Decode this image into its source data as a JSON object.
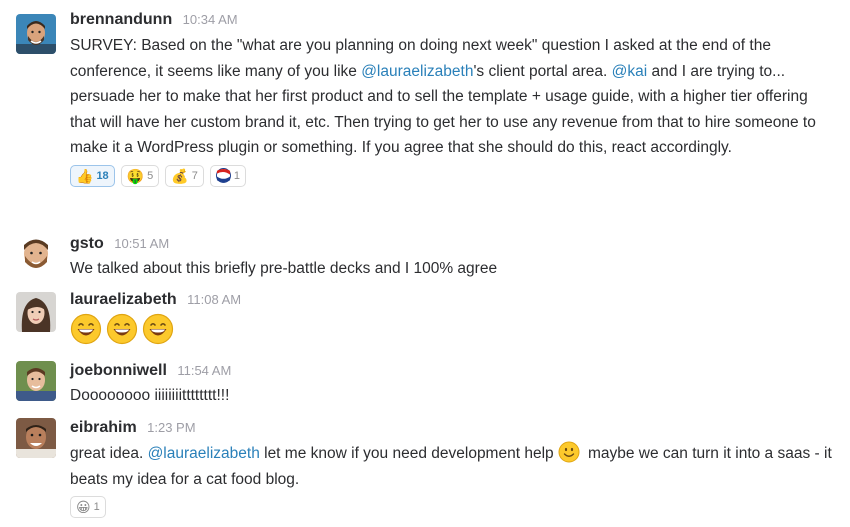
{
  "messages": [
    {
      "author": "brennandunn",
      "time": "10:34 AM",
      "parts": [
        "SURVEY: Based on the \"what are you planning on doing next week\" question I asked at the end of the conference, it seems like many of you like ",
        "@lauraelizabeth",
        "'s client portal area. ",
        "@kai",
        " and I are trying to... persuade her to make that her first product and to sell the template + usage guide, with a higher tier offering that will have her custom brand it, etc. Then trying to get her to use any revenue from that to hire someone to make it a WordPress plugin or something. If you agree that she should do this, react accordingly."
      ],
      "reactions": [
        {
          "icon": "thumbs-up-icon",
          "glyph": "👍",
          "count": "18"
        },
        {
          "icon": "money-mouth-face-icon",
          "glyph": "🤑",
          "count": "5"
        },
        {
          "icon": "money-bag-icon",
          "glyph": "💰",
          "count": "7"
        },
        {
          "icon": "pepsi-logo-icon",
          "glyph": "",
          "count": "1"
        }
      ]
    },
    {
      "author": "gsto",
      "time": "10:51 AM",
      "text": "We talked about this briefly pre-battle decks and I 100% agree"
    },
    {
      "author": "lauraelizabeth",
      "time": "11:08 AM",
      "emojis": [
        "smile-emoji-icon",
        "smile-emoji-icon",
        "smile-emoji-icon"
      ]
    },
    {
      "author": "joebonniwell",
      "time": "11:54 AM",
      "text": "Doooooooo iiiiiiiitttttttt!!!"
    },
    {
      "author": "eibrahim",
      "time": "1:23 PM",
      "parts": [
        "great idea. ",
        "@lauraelizabeth",
        " let me know if you need development help",
        " maybe we can turn it into a saas - it beats my idea for a cat food blog."
      ],
      "inline_emoji": "slightly-smiling-face-icon",
      "reactions": [
        {
          "icon": "smiley-face-icon",
          "glyph": "😀",
          "count": "1"
        }
      ]
    }
  ],
  "colors": {
    "text": "#2c2d30",
    "timestamp": "#9e9ea6",
    "mention": "#2a80b9",
    "reaction_active_bg": "#eef5fc",
    "reaction_border": "#dcdcdc"
  }
}
